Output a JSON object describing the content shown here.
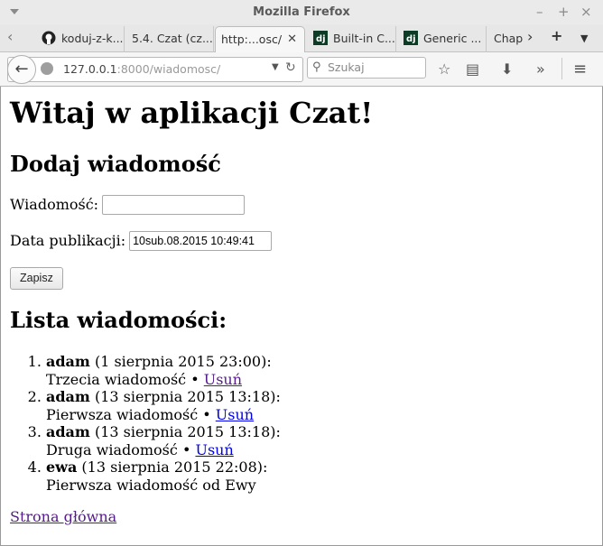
{
  "window": {
    "title": "Mozilla Firefox"
  },
  "tabs": [
    {
      "label": "koduj-z-k...",
      "favicon": "github-icon"
    },
    {
      "label": "5.4. Czat (cz....",
      "favicon": "none"
    },
    {
      "label": "http:...osc/",
      "favicon": "none",
      "active": true
    },
    {
      "label": "Built-in C...",
      "favicon": "django-icon"
    },
    {
      "label": "Generic ...",
      "favicon": "django-icon"
    },
    {
      "label": "Chap",
      "favicon": "none"
    }
  ],
  "navbar": {
    "url_host": "127.0.0.1",
    "url_rest": ":8000/wiadomosc/",
    "search_placeholder": "Szukaj"
  },
  "page": {
    "heading": "Witaj w aplikacji Czat!",
    "add_heading": "Dodaj wiadomość",
    "message_label": "Wiadomość:",
    "message_value": "",
    "date_label": "Data publikacji:",
    "date_value": "10sub.08.2015 10:49:41",
    "submit_label": "Zapisz",
    "list_heading": "Lista wiadomości:",
    "messages": [
      {
        "author": "adam",
        "date": " (1 sierpnia 2015 23:00):",
        "text": "Trzecia wiadomość • ",
        "delete": "Usuń"
      },
      {
        "author": "adam",
        "date": " (13 sierpnia 2015 13:18):",
        "text": "Pierwsza wiadomość • ",
        "delete": "Usuń"
      },
      {
        "author": "adam",
        "date": " (13 sierpnia 2015 13:18):",
        "text": "Druga wiadomość • ",
        "delete": "Usuń"
      },
      {
        "author": "ewa",
        "date": " (13 sierpnia 2015 22:08):",
        "text": "Pierwsza wiadomość od Ewy",
        "delete": ""
      }
    ],
    "home_link": "Strona główna"
  },
  "colors": {
    "link": "#0000ee",
    "visited": "#551a8b",
    "chrome": "#e7e7e7"
  }
}
